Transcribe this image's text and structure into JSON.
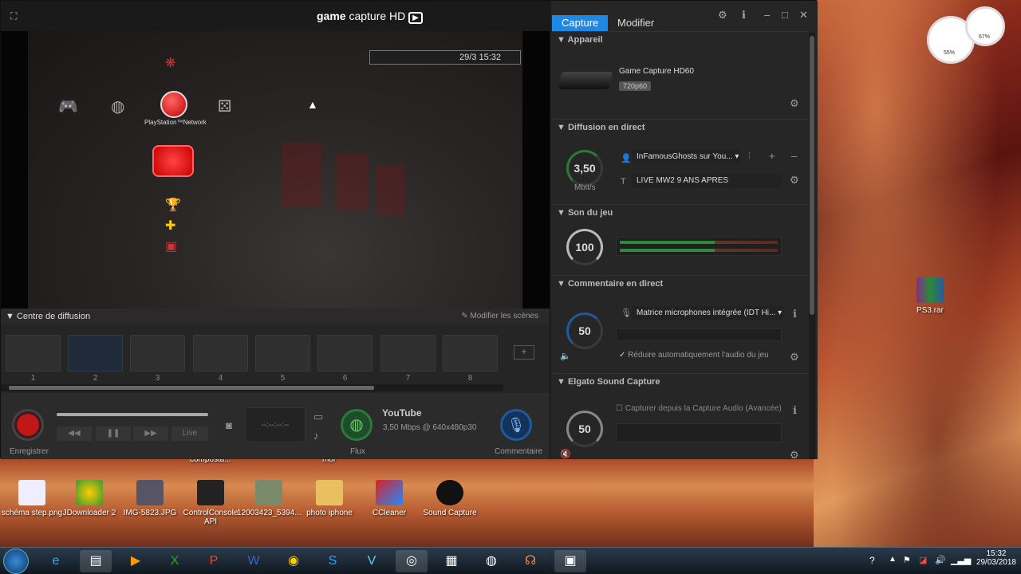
{
  "app": {
    "brand_bold": "game",
    "brand_rest": " capture HD"
  },
  "preview": {
    "clock": "29/3 15:32",
    "psn_label": "PlayStation™Network"
  },
  "scenes": {
    "title": "Centre de diffusion",
    "modify": "Modifier les scènes",
    "items": [
      "1",
      "2",
      "3",
      "4",
      "5",
      "6",
      "7",
      "8"
    ]
  },
  "controls": {
    "record_label": "Enregistrer",
    "rewind": "◀◀",
    "pause": "❚❚",
    "forward": "▶▶",
    "live": "Live",
    "timecode": "--:--:--:--",
    "flux_label": "Flux",
    "youtube": "YouTube",
    "stream_info": "3,50 Mbps @ 640x480p30",
    "commentary_label": "Commentaire"
  },
  "panel": {
    "tab_capture": "Capture",
    "tab_modify": "Modifier",
    "device_header": "Appareil",
    "device_name": "Game Capture HD60",
    "device_badge": "720p60",
    "live_header": "Diffusion en direct",
    "bitrate": "3,50",
    "bitrate_unit": "Mbit/s",
    "account": "InFamousGhosts sur You...",
    "stream_title": "LIVE MW2 9 ANS APRES",
    "game_sound_header": "Son du jeu",
    "game_volume": "100",
    "commentary_header": "Commentaire en direct",
    "commentary_volume": "50",
    "mic_name": "Matrice microphones intégrée (IDT Hi...",
    "reduce_audio": "Réduire automatiquement l'audio du jeu",
    "sound_capture_header": "Elgato Sound Capture",
    "sound_capture_option": "Capturer depuis la Capture Audio (Avancée)",
    "sound_capture_volume": "50"
  },
  "desktop": {
    "icons": [
      {
        "label": "schéma step.png"
      },
      {
        "label": "JDownloader 2"
      },
      {
        "label": "IMG-5823.JPG"
      },
      {
        "label": "ControlConsole API"
      },
      {
        "label": "12003423_5394..."
      },
      {
        "label": "photo iphone"
      },
      {
        "label": "CCleaner"
      },
      {
        "label": "Sound Capture"
      }
    ],
    "behind_labels": [
      "composta...",
      "moi"
    ],
    "rar_label": "PS3.rar",
    "gauge1": "55%",
    "gauge2": "67%"
  },
  "taskbar": {
    "time": "15:32",
    "date": "29/03/2018"
  }
}
